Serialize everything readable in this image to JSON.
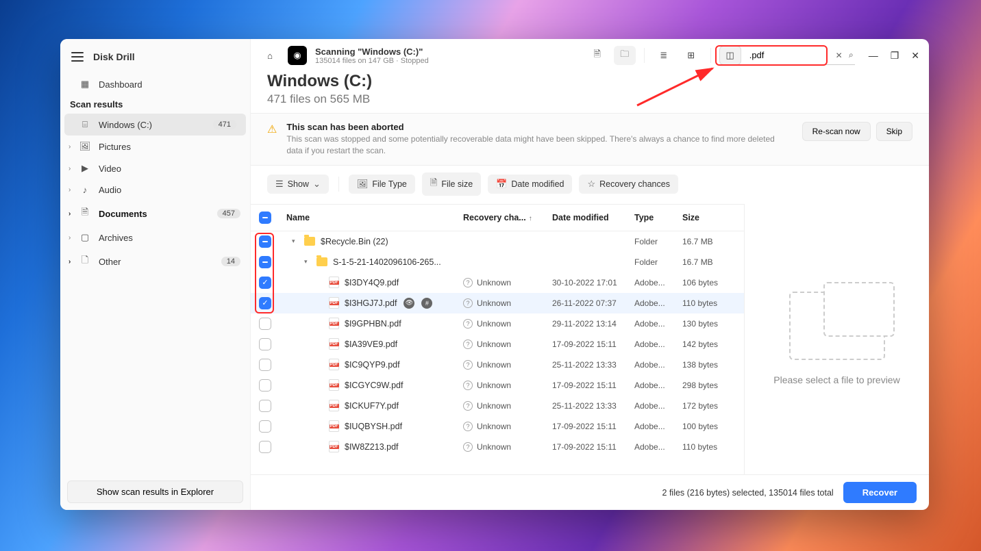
{
  "app": {
    "title": "Disk Drill"
  },
  "sidebar": {
    "dashboard": "Dashboard",
    "section": "Scan results",
    "items": [
      {
        "label": "Windows (C:)",
        "badge": "471"
      },
      {
        "label": "Pictures"
      },
      {
        "label": "Video"
      },
      {
        "label": "Audio"
      },
      {
        "label": "Documents",
        "badge": "457"
      },
      {
        "label": "Archives"
      },
      {
        "label": "Other",
        "badge": "14"
      }
    ],
    "footer_btn": "Show scan results in Explorer"
  },
  "topbar": {
    "title": "Scanning \"Windows (C:)\"",
    "subtitle": "135014 files on 147 GB · Stopped",
    "search_value": ".pdf"
  },
  "location": {
    "title": "Windows (C:)",
    "subtitle": "471 files on 565 MB"
  },
  "warning": {
    "title": "This scan has been aborted",
    "body": "This scan was stopped and some potentially recoverable data might have been skipped. There's always a chance to find more deleted data if you restart the scan.",
    "rescan": "Re-scan now",
    "skip": "Skip"
  },
  "filters": {
    "show": "Show",
    "filetype": "File Type",
    "filesize": "File size",
    "datemod": "Date modified",
    "recovery": "Recovery chances"
  },
  "columns": {
    "name": "Name",
    "recovery": "Recovery cha...",
    "date": "Date modified",
    "type": "Type",
    "size": "Size"
  },
  "rows": [
    {
      "kind": "folder",
      "indent": 0,
      "expanded": true,
      "check": "indet",
      "name": "$Recycle.Bin (22)",
      "recovery": "",
      "date": "",
      "type": "Folder",
      "size": "16.7 MB"
    },
    {
      "kind": "folder",
      "indent": 1,
      "expanded": true,
      "check": "indet",
      "name": "S-1-5-21-1402096106-265...",
      "recovery": "",
      "date": "",
      "type": "Folder",
      "size": "16.7 MB"
    },
    {
      "kind": "pdf",
      "indent": 2,
      "check": "checked",
      "name": "$I3DY4Q9.pdf",
      "recovery": "Unknown",
      "date": "30-10-2022 17:01",
      "type": "Adobe...",
      "size": "106 bytes"
    },
    {
      "kind": "pdf",
      "indent": 2,
      "check": "checked",
      "name": "$I3HGJ7J.pdf",
      "recovery": "Unknown",
      "date": "26-11-2022 07:37",
      "type": "Adobe...",
      "size": "110 bytes",
      "hover": true,
      "badges": true
    },
    {
      "kind": "pdf",
      "indent": 2,
      "check": "",
      "name": "$I9GPHBN.pdf",
      "recovery": "Unknown",
      "date": "29-11-2022 13:14",
      "type": "Adobe...",
      "size": "130 bytes"
    },
    {
      "kind": "pdf",
      "indent": 2,
      "check": "",
      "name": "$IA39VE9.pdf",
      "recovery": "Unknown",
      "date": "17-09-2022 15:11",
      "type": "Adobe...",
      "size": "142 bytes"
    },
    {
      "kind": "pdf",
      "indent": 2,
      "check": "",
      "name": "$IC9QYP9.pdf",
      "recovery": "Unknown",
      "date": "25-11-2022 13:33",
      "type": "Adobe...",
      "size": "138 bytes"
    },
    {
      "kind": "pdf",
      "indent": 2,
      "check": "",
      "name": "$ICGYC9W.pdf",
      "recovery": "Unknown",
      "date": "17-09-2022 15:11",
      "type": "Adobe...",
      "size": "298 bytes"
    },
    {
      "kind": "pdf",
      "indent": 2,
      "check": "",
      "name": "$ICKUF7Y.pdf",
      "recovery": "Unknown",
      "date": "25-11-2022 13:33",
      "type": "Adobe...",
      "size": "172 bytes"
    },
    {
      "kind": "pdf",
      "indent": 2,
      "check": "",
      "name": "$IUQBYSH.pdf",
      "recovery": "Unknown",
      "date": "17-09-2022 15:11",
      "type": "Adobe...",
      "size": "100 bytes"
    },
    {
      "kind": "pdf",
      "indent": 2,
      "check": "",
      "name": "$IW8Z213.pdf",
      "recovery": "Unknown",
      "date": "17-09-2022 15:11",
      "type": "Adobe...",
      "size": "110 bytes"
    }
  ],
  "preview": {
    "text": "Please select a file to preview"
  },
  "status": {
    "text": "2 files (216 bytes) selected, 135014 files total",
    "recover": "Recover"
  }
}
